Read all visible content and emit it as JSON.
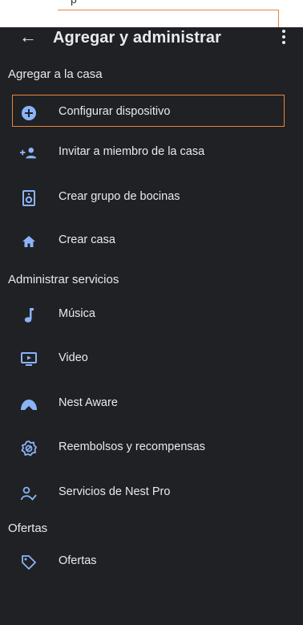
{
  "annotation": {
    "caption": "p"
  },
  "appbar": {
    "title": "Agregar y administrar",
    "back_icon": "arrow-back-icon",
    "menu_icon": "more-vert-icon"
  },
  "sections": {
    "add": "Agregar a la casa",
    "manage": "Administrar servicios",
    "offers": "Ofertas"
  },
  "items": [
    {
      "label": "Configurar dispositivo",
      "icon": "add-circle-icon"
    },
    {
      "label": "Invitar a miembro de la casa",
      "icon": "person-add-icon"
    },
    {
      "label": "Crear grupo de bocinas",
      "icon": "speaker-icon"
    },
    {
      "label": "Crear casa",
      "icon": "home-icon"
    },
    {
      "label": "Música",
      "icon": "music-note-icon"
    },
    {
      "label": "Video",
      "icon": "video-icon"
    },
    {
      "label": "Nest Aware",
      "icon": "nest-aware-icon"
    },
    {
      "label": "Reembolsos y recompensas",
      "icon": "rewards-icon"
    },
    {
      "label": "Servicios de Nest Pro",
      "icon": "nest-pro-icon"
    },
    {
      "label": "Ofertas",
      "icon": "tag-icon"
    }
  ],
  "colors": {
    "accent": "#8ab4f8",
    "background": "#202124",
    "highlight": "#e8823a"
  }
}
